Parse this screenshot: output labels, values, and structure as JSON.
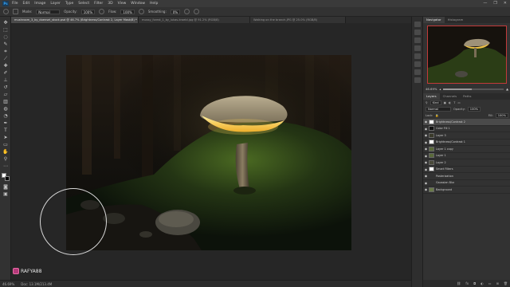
{
  "app": {
    "logo_text": "Ps"
  },
  "menu": [
    "File",
    "Edit",
    "Image",
    "Layer",
    "Type",
    "Select",
    "Filter",
    "3D",
    "View",
    "Window",
    "Help"
  ],
  "window_controls": [
    "—",
    "❐",
    "✕"
  ],
  "options_bar": {
    "mode_label": "Mode:",
    "mode_value": "Normal",
    "opacity_label": "Opacity:",
    "opacity_value": "100%",
    "flow_label": "Flow:",
    "flow_value": "100%",
    "smoothing_label": "Smoothing:",
    "smoothing_value": "0%"
  },
  "tabs": [
    {
      "label": "mushroom_3_by_doensel_stock.psd @ 46.7% (Brightness/Contrast 2, Layer Mask/8) *",
      "active": true
    },
    {
      "label": "mossy_forest_1_by_lukas-kroebl.jpg @ 91.2% (RGB/8)",
      "active": false
    },
    {
      "label": "Walking on the branch.JPG @ 25.0% (RGB/8)",
      "active": false
    }
  ],
  "status": {
    "zoom": "46.69%",
    "doc_info": "Doc: 13.1M/213.4M"
  },
  "watermark": {
    "text": "RAFYA88"
  },
  "panels": {
    "top_tabs": [
      "Navigator",
      "Histogram"
    ],
    "zoom": "46.69%",
    "zoom_level": 0.47,
    "layer_tabs": [
      "Layers",
      "Channels",
      "Paths"
    ],
    "kind_label": "Kind",
    "blend_mode": "Normal",
    "opacity_label": "Opacity:",
    "opacity": "100%",
    "lock_label": "Lock:",
    "fill_label": "Fill:",
    "fill": "100%",
    "layers": [
      {
        "name": "Brightness/Contrast 2",
        "selected": true,
        "thumb": "#ffffff"
      },
      {
        "name": "Color Fill 1",
        "selected": false,
        "thumb": "#111111"
      },
      {
        "name": "Layer 3",
        "selected": false,
        "thumb": "#3a3a2a"
      },
      {
        "name": "Brightness/Contrast 1",
        "selected": false,
        "thumb": "#ffffff"
      },
      {
        "name": "Layer 1 copy",
        "selected": false,
        "thumb": "#5a6a3a"
      },
      {
        "name": "Layer 1",
        "selected": false,
        "thumb": "#5a6a3a"
      },
      {
        "name": "Layer 2",
        "selected": false,
        "thumb": "#4a4a3a"
      },
      {
        "name": "Smart Filters",
        "selected": false,
        "thumb": "#ffffff"
      },
      {
        "name": "Posterization",
        "selected": false,
        "thumb": ""
      },
      {
        "name": "Gaussian Blur",
        "selected": false,
        "thumb": ""
      },
      {
        "name": "Background",
        "selected": false,
        "thumb": "#6a7a4a"
      }
    ]
  }
}
